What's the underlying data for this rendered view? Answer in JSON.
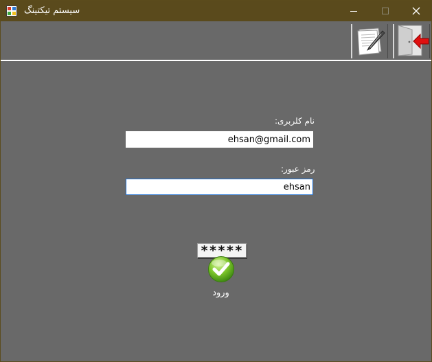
{
  "window": {
    "title": "سیستم تیکتینگ",
    "titlebar_color": "#5a4a1c",
    "background_color": "#696969",
    "controls": {
      "minimize_icon": "minimize-icon",
      "maximize_icon": "maximize-icon",
      "close_icon": "close-icon"
    }
  },
  "toolbar": {
    "items": [
      {
        "name": "register",
        "icon": "document-pen-icon"
      },
      {
        "name": "exit",
        "icon": "door-exit-arrow-icon"
      }
    ]
  },
  "form": {
    "username_label": "نام کلربری:",
    "username_value": "ehsan@gmail.com",
    "password_label": "رمز عبور:",
    "password_value": "ehsan",
    "login_button": {
      "badge_text": "*****",
      "icon": "checkmark-icon",
      "label": "ورود"
    }
  }
}
